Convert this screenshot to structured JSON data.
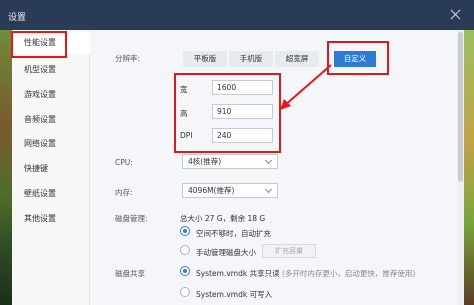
{
  "window": {
    "title": "设置"
  },
  "sidebar": {
    "items": [
      {
        "label": "性能设置"
      },
      {
        "label": "机型设置"
      },
      {
        "label": "游戏设置"
      },
      {
        "label": "音频设置"
      },
      {
        "label": "网络设置"
      },
      {
        "label": "快捷键"
      },
      {
        "label": "壁纸设置"
      },
      {
        "label": "其他设置"
      }
    ]
  },
  "resolution": {
    "label": "分辨率:",
    "options": [
      "平板版",
      "手机版",
      "超宽屏",
      "自定义"
    ],
    "selected": "自定义",
    "custom": {
      "width_label": "宽",
      "width_value": "1600",
      "height_label": "高",
      "height_value": "910",
      "dpi_label": "DPI",
      "dpi_value": "240"
    }
  },
  "cpu": {
    "label": "CPU:",
    "value": "4核(推荐)"
  },
  "memory": {
    "label": "内存:",
    "value": "4096M(推荐)"
  },
  "disk": {
    "label": "磁盘管理:",
    "summary": "总大小 27 G，剩余 18 G",
    "option_auto": "空间不够时，自动扩充",
    "option_manual": "手动管理磁盘大小",
    "expand_button": "扩充容量",
    "selected": "auto"
  },
  "disk_share": {
    "label": "磁盘共享",
    "option_readonly": "System.vmdk 共享只读",
    "option_readonly_hint": "(多开时内存更小，启动更快，推荐使用)",
    "option_writable": "System.vmdk 可写入",
    "selected": "readonly"
  },
  "colors": {
    "accent": "#2e7bd6",
    "highlight": "#e01919",
    "titlebar": "#2a3b55"
  }
}
